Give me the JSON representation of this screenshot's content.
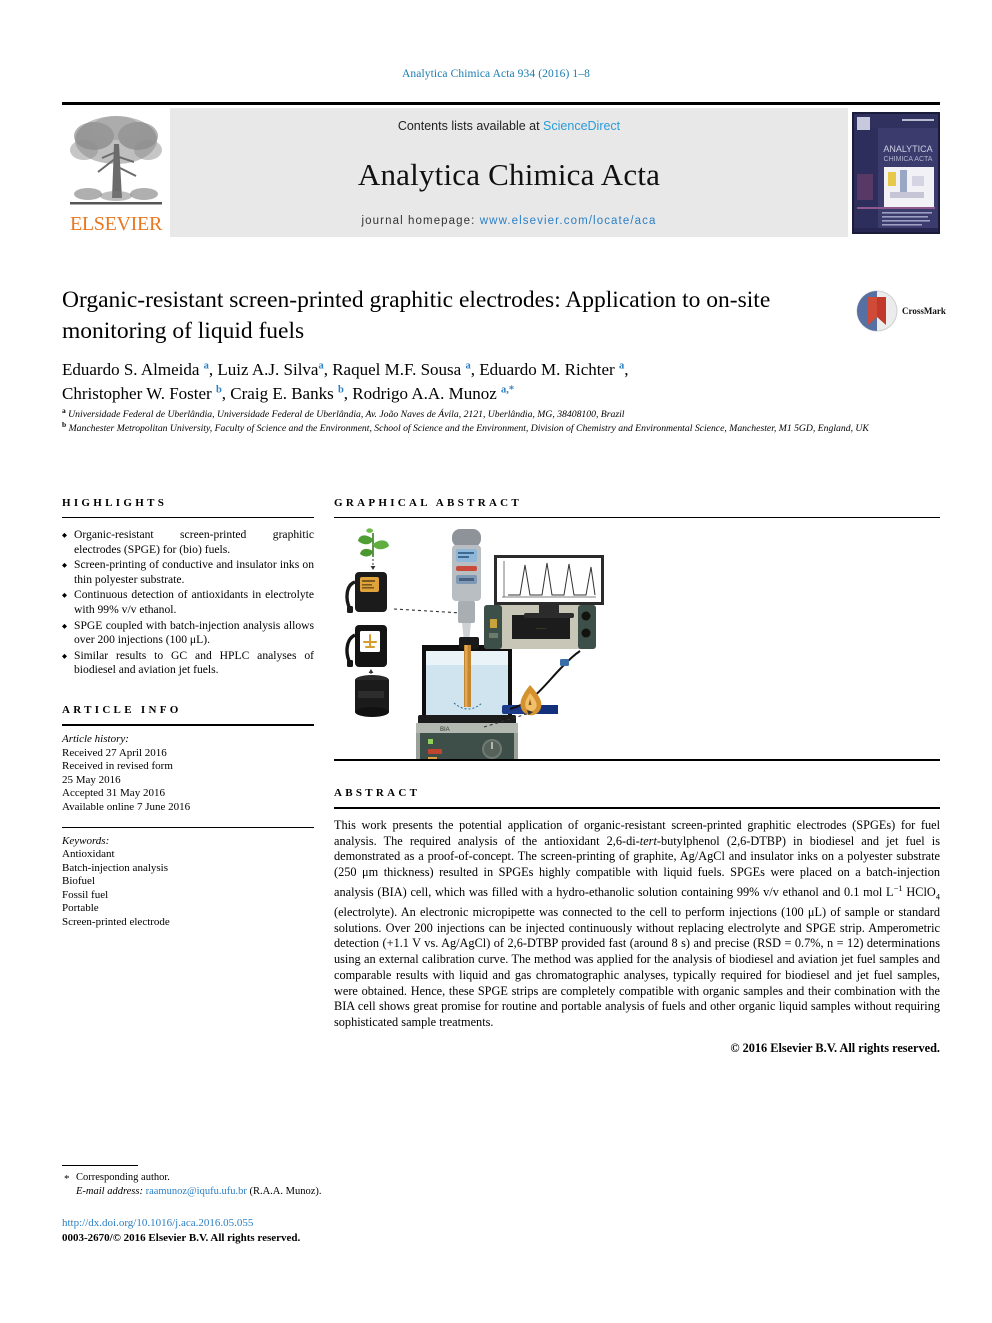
{
  "running_head": "Analytica Chimica Acta 934 (2016) 1–8",
  "masthead": {
    "contents_prefix": "Contents lists available at ",
    "sciencedirect": "ScienceDirect",
    "journal_title": "Analytica Chimica Acta",
    "homepage_prefix": "journal homepage: ",
    "homepage_url": "www.elsevier.com/locate/aca",
    "publisher": "ELSEVIER",
    "cover_title_line1": "ANALYTICA",
    "cover_title_line2": "CHIMICA ACTA"
  },
  "article": {
    "title": "Organic-resistant screen-printed graphitic electrodes: Application to on-site monitoring of liquid fuels",
    "crossmark_label": "CrossMark",
    "authors_line1": "Eduardo S. Almeida <a>, Luiz A.J. Silva <a>, Raquel M.F. Sousa <a>, Eduardo M. Richter <a>,",
    "authors_line2": "Christopher W. Foster <b>, Craig E. Banks <b>, Rodrigo A.A. Munoz <a,*>",
    "affiliation_a": "Universidade Federal de Uberlândia, Universidade Federal de Uberlândia, Av. João Naves de Ávila, 2121, Uberlândia, MG, 38408100, Brazil",
    "affiliation_b": "Manchester Metropolitan University, Faculty of Science and the Environment, School of Science and the Environment, Division of Chemistry and Environmental Science, Manchester, M1 5GD, England, UK"
  },
  "sections": {
    "highlights_heading": "HIGHLIGHTS",
    "graphical_abstract_heading": "GRAPHICAL ABSTRACT",
    "article_info_heading": "ARTICLE INFO",
    "abstract_heading": "ABSTRACT"
  },
  "highlights": [
    "Organic-resistant screen-printed graphitic electrodes (SPGE) for (bio) fuels.",
    "Screen-printing of conductive and insulator inks on thin polyester substrate.",
    "Continuous detection of antioxidants in electrolyte with 99% v/v ethanol.",
    "SPGE coupled with batch-injection analysis allows over 200 injections (100 μL).",
    "Similar results to GC and HPLC analyses of biodiesel and aviation jet fuels."
  ],
  "article_history": {
    "label": "Article history:",
    "lines": [
      "Received 27 April 2016",
      "Received in revised form",
      "25 May 2016",
      "Accepted 31 May 2016",
      "Available online 7 June 2016"
    ]
  },
  "keywords": {
    "label": "Keywords:",
    "items": [
      "Antioxidant",
      "Batch-injection analysis",
      "Biofuel",
      "Fossil fuel",
      "Portable",
      "Screen-printed electrode"
    ]
  },
  "abstract": {
    "paragraph_1": "This work presents the potential application of organic-resistant screen-printed graphitic electrodes (SPGEs) for fuel analysis. The required analysis of the antioxidant 2,6-di-",
    "tert_italic": "tert",
    "paragraph_2": "-butylphenol (2,6-DTBP) in biodiesel and jet fuel is demonstrated as a proof-of-concept. The screen-printing of graphite, Ag/AgCl and insulator inks on a polyester substrate (250 μm thickness) resulted in SPGEs highly compatible with liquid fuels. SPGEs were placed on a batch-injection analysis (BIA) cell, which was filled with a hydro-ethanolic solution containing 99% v/v ethanol and 0.1 mol L",
    "sup_1": "−1",
    "paragraph_3": " HClO",
    "sub_4": "4",
    "paragraph_4": " (electrolyte). An electronic micropipette was connected to the cell to perform injections (100 μL) of sample or standard solutions. Over 200 injections can be injected continuously without replacing electrolyte and SPGE strip. Amperometric detection (+1.1 V vs. Ag/AgCl) of 2,6-DTBP provided fast (around 8 s) and precise (RSD = 0.7%, n = 12) determinations using an external calibration curve. The method was applied for the analysis of biodiesel and aviation jet fuel samples and comparable results with liquid and gas chromatographic analyses, typically required for biodiesel and jet fuel samples, were obtained. Hence, these SPGE strips are completely compatible with organic samples and their combination with the BIA cell shows great promise for routine and portable analysis of fuels and other organic liquid samples without requiring sophisticated sample treatments.",
    "copyright": "© 2016 Elsevier B.V. All rights reserved."
  },
  "footer": {
    "corresponding_author": "Corresponding author.",
    "email_label": "E-mail address:",
    "email": "raamunoz@iqufu.ufu.br",
    "email_suffix": "(R.A.A. Munoz).",
    "doi": "http://dx.doi.org/10.1016/j.aca.2016.05.055",
    "issn_line": "0003-2670/© 2016 Elsevier B.V. All rights reserved."
  },
  "colors": {
    "link_blue": "#2b7fc4",
    "sciencedirect_blue": "#2b9cd8",
    "elsevier_orange": "#e87722",
    "running_head_blue": "#1a7cb0"
  }
}
